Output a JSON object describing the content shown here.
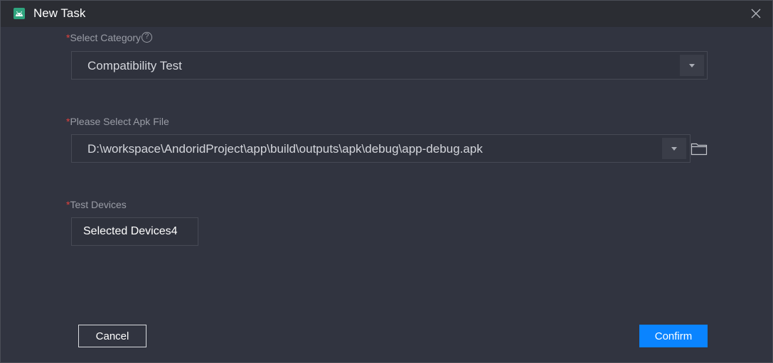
{
  "window": {
    "title": "New Task",
    "icon": "android-icon",
    "close_icon": "close-icon"
  },
  "form": {
    "category": {
      "required_mark": "*",
      "label": "Select Category",
      "help_icon": "?",
      "value": "Compatibility Test"
    },
    "apk": {
      "required_mark": "*",
      "label": "Please Select Apk File",
      "value": "D:\\workspace\\AndoridProject\\app\\build\\outputs\\apk\\debug\\app-debug.apk",
      "folder_icon": "folder-icon"
    },
    "devices": {
      "required_mark": "*",
      "label": "Test Devices",
      "button_label": "Selected Devices4"
    }
  },
  "footer": {
    "cancel_label": "Cancel",
    "confirm_label": "Confirm"
  },
  "colors": {
    "accent": "#0a84ff",
    "required": "#e0413d",
    "background": "#313440"
  }
}
